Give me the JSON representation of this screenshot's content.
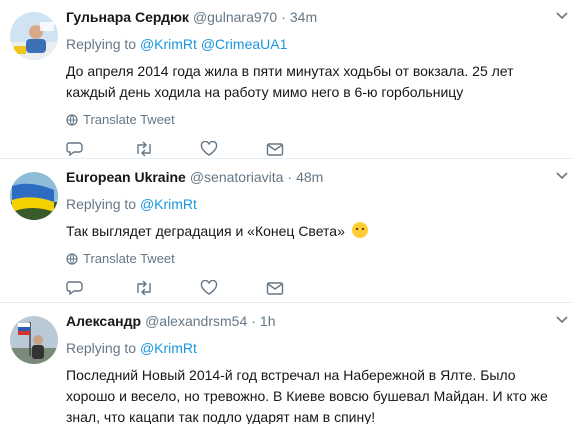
{
  "colors": {
    "link": "#1b95e0",
    "muted": "#657786",
    "text": "#14171a",
    "divider": "#e6ecf0"
  },
  "tweets": [
    {
      "name": "Гульнара Сердюк",
      "handle": "@gulnara970",
      "time": "34m",
      "replying_label": "Replying to",
      "mentions": [
        "@KrimRt",
        "@CrimeaUA1"
      ],
      "text": "До апреля 2014 года жила в пяти минутах ходьбы от вокзала. 25 лет каждый день ходила на работу мимо него в 6-ю горбольницу",
      "translate": "Translate Tweet"
    },
    {
      "name": "European Ukraine",
      "handle": "@senatoriavita",
      "time": "48m",
      "replying_label": "Replying to",
      "mentions": [
        "@KrimRt"
      ],
      "text": "Так выглядет деградация и «Конец Света»",
      "translate": "Translate Tweet"
    },
    {
      "name": "Александр",
      "handle": "@alexandrsm54",
      "time": "1h",
      "replying_label": "Replying to",
      "mentions": [
        "@KrimRt"
      ],
      "text": "Последний Новый 2014-й год встречал на Набережной в Ялте. Было хорошо и весело, но тревожно. В Киеве вовсю бушевал Майдан. И кто же знал, что кацапи так подло ударят нам в спину!"
    }
  ],
  "icons": [
    "caret-down-icon",
    "globe-icon",
    "reply-icon",
    "retweet-icon",
    "like-icon",
    "dm-icon",
    "speechless-emoji-icon"
  ]
}
